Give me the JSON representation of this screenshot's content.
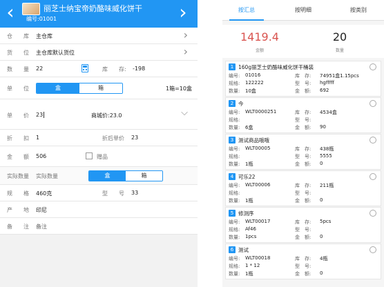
{
  "left": {
    "header": {
      "title": "丽芝士纳宝帝奶酪味威化饼干",
      "code": "编号:01001"
    },
    "fields": {
      "warehouse": {
        "label": "仓　　库",
        "value": "主仓库"
      },
      "location": {
        "label": "货　　位",
        "value": "主仓库默认货位"
      },
      "quantity": {
        "label": "数　　量",
        "value": "22"
      },
      "stock": {
        "label": "库　　存:",
        "value": "-198"
      },
      "unit": {
        "label": "单　　位",
        "options": [
          "盒",
          "箱"
        ],
        "selected": "盒",
        "ratio": "1箱=10盒"
      },
      "price": {
        "label": "单　　价",
        "value": "23",
        "mall_price": "商城价:23.0"
      },
      "discount": {
        "label": "折　　扣",
        "value": "1",
        "discounted_label": "折后单价",
        "discounted_value": "23"
      },
      "amount": {
        "label": "金　　额",
        "value": "506",
        "gift_label": "赠品"
      },
      "actual_qty": {
        "label": "实际数量",
        "options": [
          "盒",
          "箱"
        ],
        "selected": "盒"
      },
      "spec": {
        "label": "规　　格",
        "value": "460克",
        "model_label": "型　　号",
        "model_value": "33"
      },
      "origin": {
        "label": "产　　地",
        "value": "印尼"
      },
      "note": {
        "label": "备　　注",
        "placeholder": "备注"
      }
    }
  },
  "right": {
    "tabs": [
      "按汇总",
      "按明细",
      "按类别"
    ],
    "active_tab": "按汇总",
    "summary": {
      "amount": "1419.4",
      "amount_label": "金额",
      "count": "20",
      "count_label": "数量"
    },
    "items": [
      {
        "index": "1",
        "name": "160g丽芝士奶酪味威化饼干桶装",
        "code": "01016",
        "stock": "74951盒1.15pcs",
        "spec": "122222",
        "model": "hgfffff",
        "qty": "10盒",
        "amount": "692"
      },
      {
        "index": "2",
        "name": "今",
        "code": "WLT0000251",
        "stock": "4534盒",
        "spec": "",
        "model": "",
        "qty": "6盒",
        "amount": "90"
      },
      {
        "index": "3",
        "name": "测试商品哦哦",
        "code": "WLT00005",
        "stock": "438瓶",
        "spec": "",
        "model": "5555",
        "qty": "1瓶",
        "amount": "0"
      },
      {
        "index": "4",
        "name": "可乐22",
        "code": "WLT00006",
        "stock": "211瓶",
        "spec": "",
        "model": "",
        "qty": "1瓶",
        "amount": "0"
      },
      {
        "index": "5",
        "name": "修测序",
        "code": "WLT00017",
        "stock": "5pcs",
        "spec": "Af46",
        "model": "",
        "qty": "1pcs",
        "amount": "0"
      },
      {
        "index": "6",
        "name": "测试",
        "code": "WLT00018",
        "stock": "4瓶",
        "spec": "1 * 12",
        "model": "",
        "qty": "1瓶",
        "amount": "0"
      }
    ],
    "keys": {
      "code": "编号:",
      "stock": "库　存:",
      "spec": "规格:",
      "model": "型　号:",
      "qty": "数量:",
      "amount": "金　额:"
    }
  }
}
